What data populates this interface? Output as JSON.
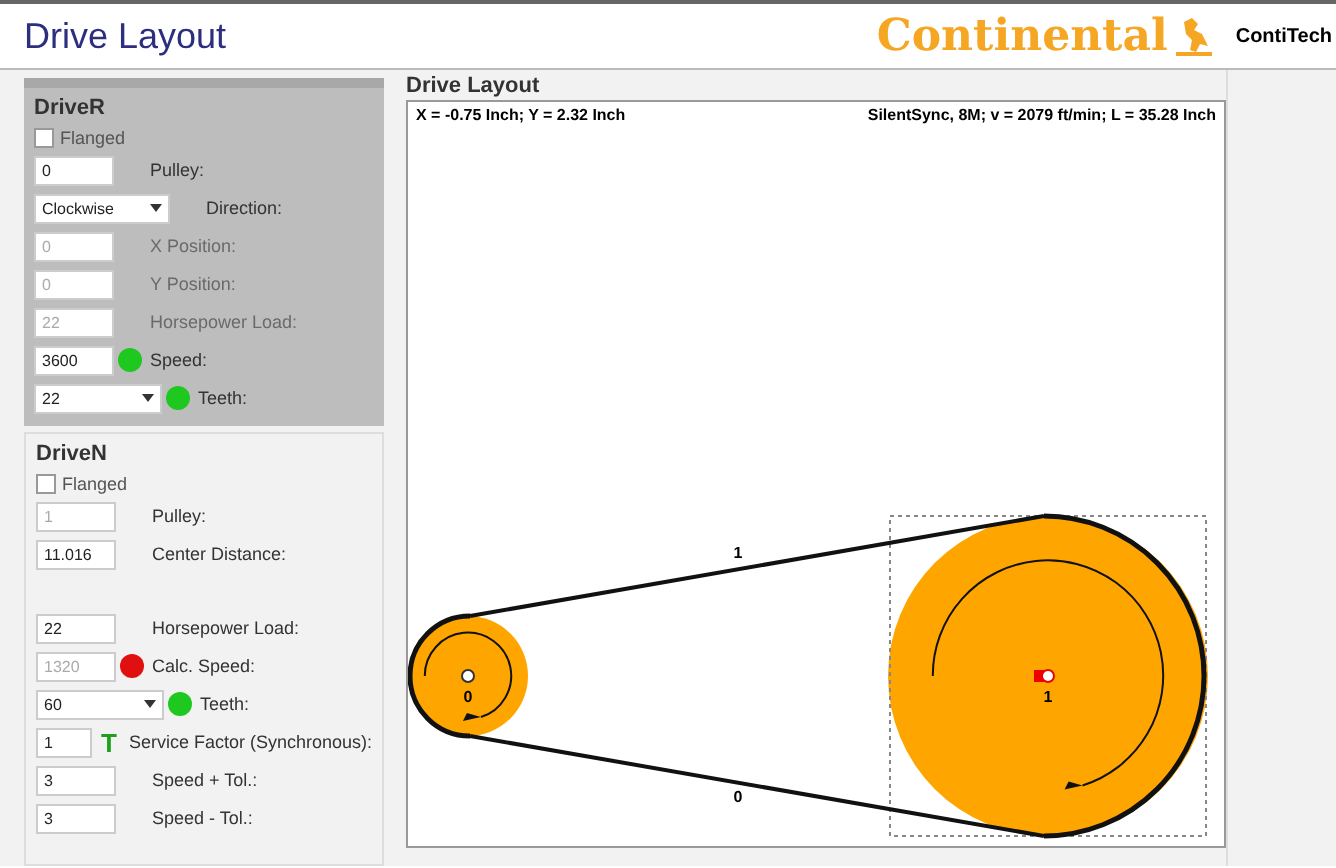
{
  "header": {
    "title": "Drive Layout",
    "logo": "Continental",
    "brand": "ContiTech"
  },
  "driver": {
    "title": "DriveR",
    "flanged": false,
    "flanged_label": "Flanged",
    "disabled": true,
    "fields": [
      {
        "kind": "input",
        "value": "0",
        "label": "Pulley:",
        "disabled": false
      },
      {
        "kind": "select",
        "value": "Clockwise",
        "label": "Direction:",
        "disabled": false
      },
      {
        "kind": "input",
        "value": "0",
        "label": "X Position:",
        "disabled": true
      },
      {
        "kind": "input",
        "value": "0",
        "label": "Y Position:",
        "disabled": true
      },
      {
        "kind": "input",
        "value": "22",
        "label": "Horsepower Load:",
        "disabled": true
      },
      {
        "kind": "input",
        "value": "3600",
        "label": "Speed:",
        "disabled": false,
        "indicator": {
          "kind": "dot",
          "color": "#1ec81e"
        }
      },
      {
        "kind": "select",
        "value": "22",
        "label": "Teeth:",
        "disabled": false,
        "indicator": {
          "kind": "dot",
          "color": "#1ec81e"
        }
      }
    ]
  },
  "driven": {
    "title": "DriveN",
    "flanged": false,
    "flanged_label": "Flanged",
    "disabled": false,
    "fields": [
      {
        "kind": "input",
        "value": "1",
        "label": "Pulley:",
        "disabled": true
      },
      {
        "kind": "input",
        "value": "11.016",
        "label": "Center Distance:",
        "disabled": false
      },
      {
        "kind": "input",
        "value": "22",
        "label": "Horsepower Load:",
        "disabled": false
      },
      {
        "kind": "input",
        "value": "1320",
        "label": "Calc. Speed:",
        "disabled": true,
        "indicator": {
          "kind": "dot",
          "color": "#e01010"
        }
      },
      {
        "kind": "select",
        "value": "60",
        "label": "Teeth:",
        "disabled": false,
        "indicator": {
          "kind": "dot",
          "color": "#1ec81e"
        }
      },
      {
        "kind": "input",
        "value": "1",
        "label": "Service Factor (Synchronous):",
        "disabled": false,
        "indicator": {
          "kind": "letter",
          "text": "T",
          "color": "#1ea01e"
        }
      },
      {
        "kind": "input",
        "value": "3",
        "label": "Speed + Tol.:",
        "disabled": false
      },
      {
        "kind": "input",
        "value": "3",
        "label": "Speed - Tol.:",
        "disabled": false
      }
    ]
  },
  "layout": {
    "title": "Drive Layout",
    "cursor": "X = -0.75 Inch; Y = 2.32 Inch",
    "belt_info": "SilentSync, 8M; v = 2079 ft/min; L = 35.28 Inch",
    "spans": [
      {
        "label": "1"
      },
      {
        "label": "0"
      }
    ],
    "pulleys": [
      {
        "label": "0",
        "selected": false
      },
      {
        "label": "1",
        "selected": true
      }
    ]
  }
}
